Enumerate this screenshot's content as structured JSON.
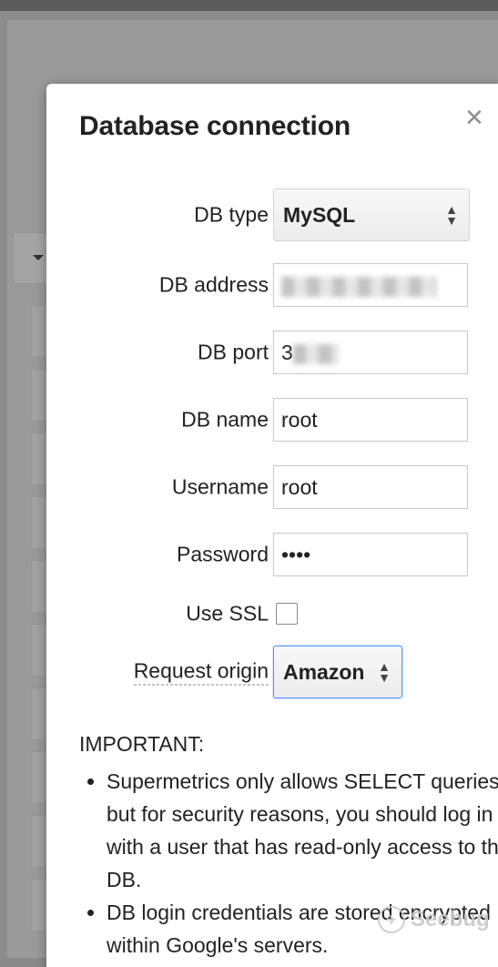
{
  "dialog": {
    "title": "Database connection",
    "close_glyph": "×"
  },
  "form": {
    "db_type": {
      "label": "DB type",
      "value": "MySQL"
    },
    "db_address": {
      "label": "DB address",
      "value": ""
    },
    "db_port": {
      "label": "DB port",
      "value": "3"
    },
    "db_name": {
      "label": "DB name",
      "value": "root"
    },
    "username": {
      "label": "Username",
      "value": "root"
    },
    "password": {
      "label": "Password",
      "value": "••••"
    },
    "use_ssl": {
      "label": "Use SSL",
      "checked": false
    },
    "request_origin": {
      "label": "Request origin",
      "value": "Amazon"
    }
  },
  "notes": {
    "heading": "IMPORTANT:",
    "items": [
      "Supermetrics only allows SELECT queries, but for security reasons, you should log in with a user that has read-only access to the DB.",
      "DB login credentials are stored encrypted within Google's servers."
    ]
  },
  "watermark": {
    "text": "Seebug",
    "icon": "seebug-logo-icon"
  },
  "colors": {
    "focus_border": "#4d90fe",
    "backdrop": "#8c8c8c"
  }
}
